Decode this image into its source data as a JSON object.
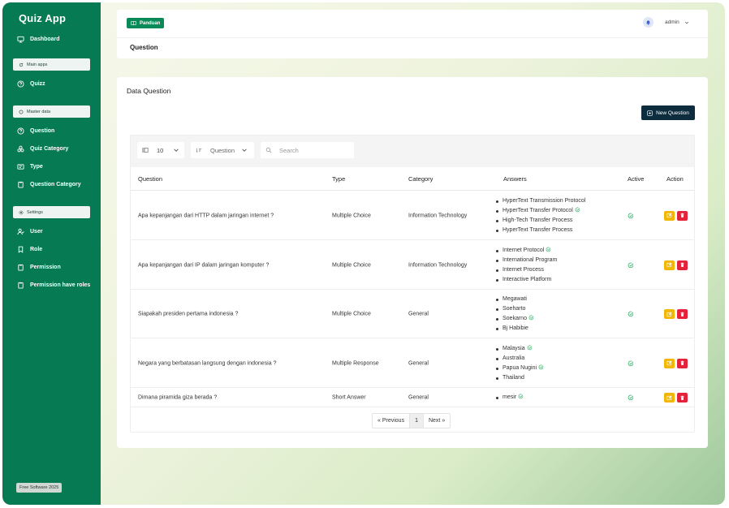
{
  "sidebar": {
    "brand": "Quiz App",
    "items": {
      "dashboard": "Dashboard",
      "main_apps": "Main apps",
      "quizz": "Quizz",
      "master_data": "Master data",
      "question": "Question",
      "quiz_category": "Quiz Category",
      "type": "Type",
      "question_category": "Question Category",
      "settings": "Settings",
      "user": "User",
      "role": "Role",
      "permission": "Permission",
      "permission_have_roles": "Permission have roles"
    },
    "footer": "Free Software 2025"
  },
  "topbar": {
    "guide_label": "Panduan",
    "user_name": "admin",
    "breadcrumb": "Question"
  },
  "card": {
    "title": "Data Question",
    "new_button": "New Question"
  },
  "filters": {
    "page_size": "10",
    "field": "Question",
    "search_placeholder": "Search"
  },
  "table": {
    "headers": {
      "question": "Question",
      "type": "Type",
      "category": "Category",
      "answers": "Answers",
      "active": "Active",
      "action": "Action"
    },
    "rows": [
      {
        "question": "Apa kepanjangan dari HTTP dalam jaringan internet ?",
        "type": "Multiple Choice",
        "category": "Information Technology",
        "answers": [
          {
            "text": "HyperText Transmission Protocol",
            "correct": false
          },
          {
            "text": "HyperText Transfer Protocol",
            "correct": true
          },
          {
            "text": "High-Tech Transfer Process",
            "correct": false
          },
          {
            "text": "HyperText Transfer Process",
            "correct": false
          }
        ]
      },
      {
        "question": "Apa kepanjangan dari IP dalam jaringan komputer ?",
        "type": "Multiple Choice",
        "category": "Information Technology",
        "answers": [
          {
            "text": "Internet Protocol",
            "correct": true
          },
          {
            "text": "International Program",
            "correct": false
          },
          {
            "text": "Internet Process",
            "correct": false
          },
          {
            "text": "Interactive Platform",
            "correct": false
          }
        ]
      },
      {
        "question": "Siapakah presiden pertama indonesia ?",
        "type": "Multiple Choice",
        "category": "General",
        "answers": [
          {
            "text": "Megawati",
            "correct": false
          },
          {
            "text": "Soeharto",
            "correct": false
          },
          {
            "text": "Soekarno",
            "correct": true
          },
          {
            "text": "Bj Habibie",
            "correct": false
          }
        ]
      },
      {
        "question": "Negara yang berbatasan langsung dengan indonesia ?",
        "type": "Multiple Response",
        "category": "General",
        "answers": [
          {
            "text": "Malaysia",
            "correct": true
          },
          {
            "text": "Australia",
            "correct": false
          },
          {
            "text": "Papua Nugini",
            "correct": true
          },
          {
            "text": "Thailand",
            "correct": false
          }
        ]
      },
      {
        "question": "Dimana piramida giza berada ?",
        "type": "Short Answer",
        "category": "General",
        "answers": [
          {
            "text": "mesir",
            "correct": true
          }
        ]
      }
    ]
  },
  "pagination": {
    "previous": "« Previous",
    "current": "1",
    "next": "Next »"
  },
  "colors": {
    "sidebar": "#067a52",
    "accent": "#0b8a59",
    "edit": "#f2b705",
    "delete": "#e4233b",
    "primary_button": "#0d2d3f"
  }
}
